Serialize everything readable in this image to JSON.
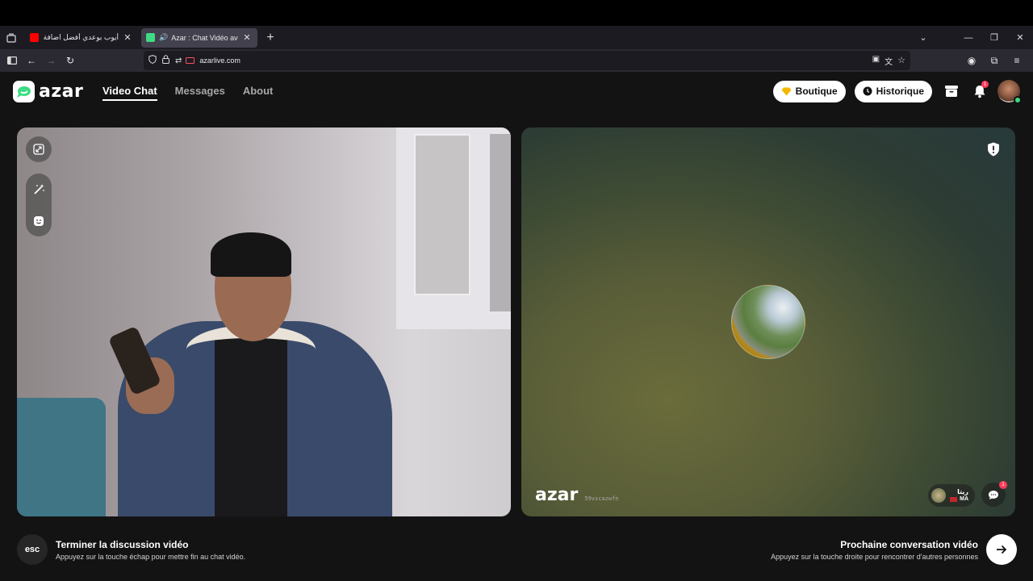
{
  "browser": {
    "tabs": [
      {
        "title": "أيوب بوعدي أفضل اضافة؟ عيسى",
        "favicon": "youtube-icon",
        "active": false
      },
      {
        "title": "Azar : Chat Vidéo avec de nouvelles personnes",
        "favicon": "azar-icon",
        "active": true
      }
    ],
    "url": "azarlive.com"
  },
  "header": {
    "logo_text": "azar",
    "nav": [
      {
        "label": "Video Chat",
        "active": true
      },
      {
        "label": "Messages",
        "active": false
      },
      {
        "label": "About",
        "active": false
      }
    ],
    "boutique_label": "Boutique",
    "history_label": "Historique",
    "notification_count": "1"
  },
  "remote": {
    "watermark": "azar",
    "user_id": "59vscazwfn",
    "user_name": "ريتا",
    "country": "MA",
    "chat_badge": "1"
  },
  "footer": {
    "esc_key": "esc",
    "end_title": "Terminer la discussion vidéo",
    "end_hint": "Appuyez sur la touche échap pour mettre fin au chat vidéo.",
    "next_title": "Prochaine conversation vidéo",
    "next_hint": "Appuyez sur la touche droite pour rencontrer d'autres personnes"
  },
  "colors": {
    "accent": "#3ddc84",
    "background": "#131313",
    "badge": "#ff3b5c"
  }
}
